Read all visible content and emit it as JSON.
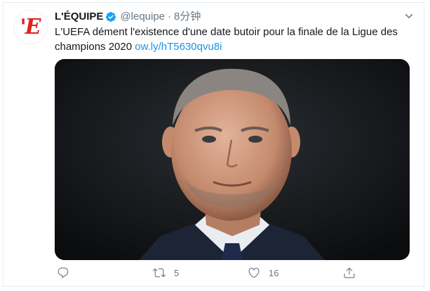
{
  "tweet": {
    "author_name": "L'ÉQUIPE",
    "handle": "@lequipe",
    "separator": "·",
    "time": "8分钟",
    "avatar_text": "'E",
    "text": "L'UEFA dément l'existence d'une date butoir pour la finale de la Ligue des champions 2020 ",
    "link": "ow.ly/hT5630qvu8i"
  },
  "actions": {
    "reply_icon": "reply-icon",
    "retweet_icon": "retweet-icon",
    "retweet_count": "5",
    "like_icon": "heart-icon",
    "like_count": "16",
    "share_icon": "share-icon"
  },
  "colors": {
    "brand_red": "#e2231a",
    "verified_blue": "#1da1f2",
    "link_blue": "#1b95e0",
    "muted_gray": "#657786"
  }
}
